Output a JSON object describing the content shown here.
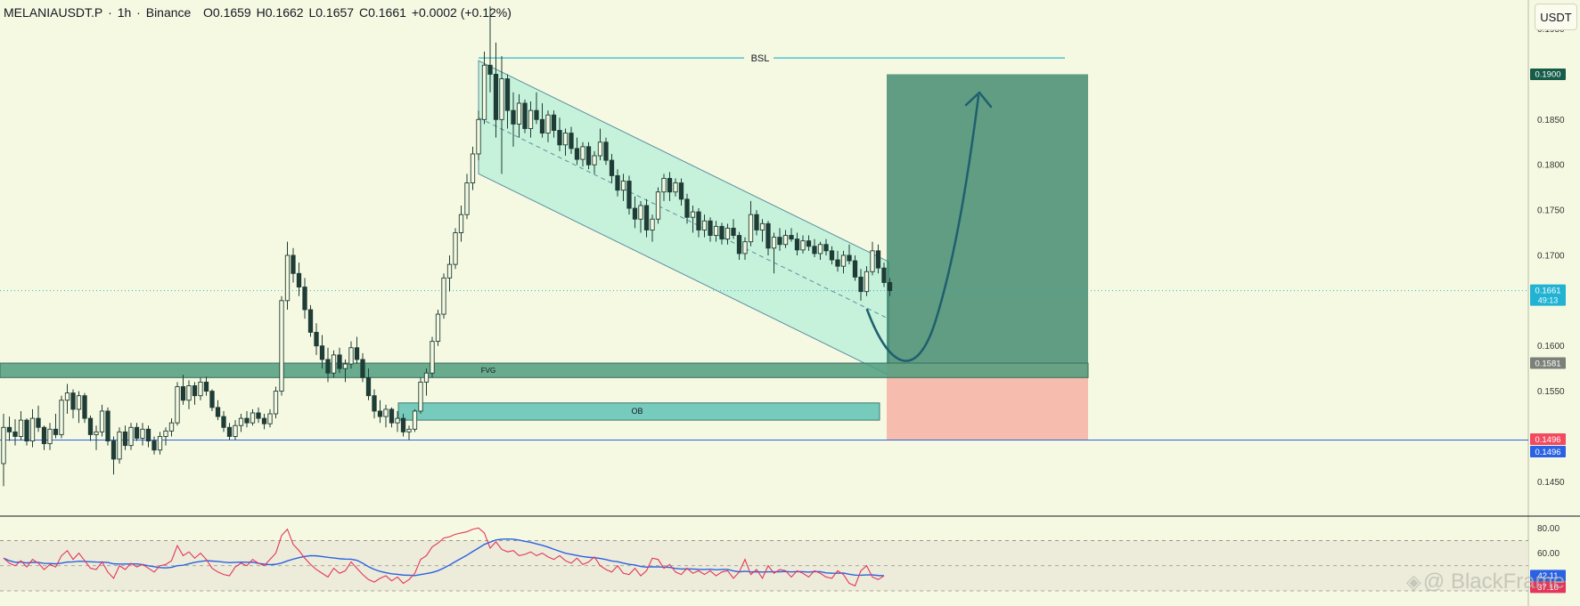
{
  "legend": {
    "symbol": "MELANIAUSDT.P",
    "interval": "1h",
    "exchange": "Binance",
    "open_label": "O",
    "open": "0.1659",
    "high_label": "H",
    "high": "0.1662",
    "low_label": "L",
    "low": "0.1657",
    "close_label": "C",
    "close": "0.1661",
    "change": "+0.0002 (+0.12%)"
  },
  "currency_button": "USDT",
  "price_axis": {
    "ticks": [
      "0.1950",
      "0.1900",
      "0.1850",
      "0.1800",
      "0.1750",
      "0.1700",
      "0.1650",
      "0.1600",
      "0.1550",
      "0.1500",
      "0.1450"
    ],
    "ticks_values": [
      0.195,
      0.19,
      0.185,
      0.18,
      0.175,
      0.17,
      0.165,
      0.16,
      0.155,
      0.15,
      0.145
    ]
  },
  "indicator_axis": {
    "ticks": [
      "80.00",
      "60.00"
    ],
    "ticks_values": [
      80,
      60
    ]
  },
  "badges": {
    "target": {
      "text": "0.1900",
      "value": 0.19,
      "color": "#165c49"
    },
    "current": {
      "text": "0.1661",
      "subtext": "49:13",
      "value": 0.1661,
      "color": "#22b3d3"
    },
    "fvg_level": {
      "text": "0.1581",
      "value": 0.1581,
      "color": "#7b8179"
    },
    "stop": {
      "text": "0.1496",
      "value": 0.1496,
      "color": "#f24a5f"
    },
    "line": {
      "text": "0.1496",
      "value": 0.1496,
      "color": "#2a62e3"
    },
    "rsi": {
      "text": "42.11",
      "value": 42.11,
      "color": "#2a62e3"
    },
    "rsi_ma": {
      "text": "37.10",
      "value": 37.1,
      "color": "#e4365a"
    }
  },
  "annotations": {
    "bsl": "BSL",
    "fvg": "FVG",
    "ob": "OB"
  },
  "watermark": {
    "text": "@ BlackFrame",
    "icon": "diamond-logo-icon"
  },
  "colors": {
    "background": "#f6f9e2",
    "bull_candle": "#1f3d36",
    "bear_candle": "#1f3d36",
    "channel_fill": "#bdf0d8",
    "channel_border": "#5a8fa3",
    "target_zone": "#2e7d63",
    "stop_zone": "#f6b2a4",
    "fvg_zone": "#4f9d7e",
    "ob_zone": "#6fc8bb",
    "bsl_line": "#2fb7cf",
    "stop_line": "#2a62e3",
    "curve_arrow": "#1f5f6e",
    "rsi_line": "#e4365a",
    "rsi_ma_line": "#2a62e3",
    "rsi_band": "#ece9d8"
  },
  "chart_data": {
    "type": "candlestick",
    "price_range": [
      0.1412,
      0.1982
    ],
    "candles": [
      [
        0.147,
        0.1525,
        0.1445,
        0.151
      ],
      [
        0.151,
        0.1522,
        0.1495,
        0.1505
      ],
      [
        0.1505,
        0.1519,
        0.149,
        0.15
      ],
      [
        0.15,
        0.1528,
        0.1496,
        0.1518
      ],
      [
        0.1518,
        0.152,
        0.149,
        0.1495
      ],
      [
        0.1495,
        0.153,
        0.1488,
        0.152
      ],
      [
        0.152,
        0.1534,
        0.1505,
        0.151
      ],
      [
        0.151,
        0.1512,
        0.1485,
        0.1492
      ],
      [
        0.1492,
        0.1515,
        0.1485,
        0.1508
      ],
      [
        0.1508,
        0.1525,
        0.1498,
        0.1502
      ],
      [
        0.1502,
        0.1545,
        0.1498,
        0.154
      ],
      [
        0.154,
        0.1558,
        0.1525,
        0.1548
      ],
      [
        0.1548,
        0.1552,
        0.152,
        0.153
      ],
      [
        0.153,
        0.155,
        0.1515,
        0.1545
      ],
      [
        0.1545,
        0.1548,
        0.1515,
        0.152
      ],
      [
        0.152,
        0.1523,
        0.1495,
        0.1502
      ],
      [
        0.1502,
        0.1512,
        0.1485,
        0.1505
      ],
      [
        0.1505,
        0.1535,
        0.15,
        0.1528
      ],
      [
        0.1528,
        0.1532,
        0.149,
        0.1495
      ],
      [
        0.1495,
        0.15,
        0.1458,
        0.1475
      ],
      [
        0.1475,
        0.151,
        0.147,
        0.1505
      ],
      [
        0.1505,
        0.1512,
        0.1485,
        0.149
      ],
      [
        0.149,
        0.1515,
        0.1485,
        0.151
      ],
      [
        0.151,
        0.1515,
        0.1495,
        0.1498
      ],
      [
        0.1498,
        0.1515,
        0.149,
        0.1508
      ],
      [
        0.1508,
        0.1512,
        0.1488,
        0.1495
      ],
      [
        0.1495,
        0.15,
        0.148,
        0.1485
      ],
      [
        0.1485,
        0.1505,
        0.148,
        0.15
      ],
      [
        0.15,
        0.151,
        0.149,
        0.1506
      ],
      [
        0.1506,
        0.152,
        0.15,
        0.1515
      ],
      [
        0.1515,
        0.156,
        0.1512,
        0.1555
      ],
      [
        0.1555,
        0.1568,
        0.1535,
        0.154
      ],
      [
        0.154,
        0.1562,
        0.153,
        0.1556
      ],
      [
        0.1556,
        0.156,
        0.1535,
        0.1545
      ],
      [
        0.1545,
        0.1565,
        0.154,
        0.156
      ],
      [
        0.156,
        0.1566,
        0.1545,
        0.155
      ],
      [
        0.155,
        0.1552,
        0.1528,
        0.1532
      ],
      [
        0.1532,
        0.154,
        0.1518,
        0.1522
      ],
      [
        0.1522,
        0.1528,
        0.1505,
        0.151
      ],
      [
        0.151,
        0.1515,
        0.1496,
        0.15
      ],
      [
        0.15,
        0.1518,
        0.1496,
        0.1512
      ],
      [
        0.1512,
        0.1525,
        0.1505,
        0.152
      ],
      [
        0.152,
        0.1528,
        0.151,
        0.1515
      ],
      [
        0.1515,
        0.153,
        0.1512,
        0.1526
      ],
      [
        0.1526,
        0.1532,
        0.1515,
        0.152
      ],
      [
        0.152,
        0.1525,
        0.1508,
        0.1514
      ],
      [
        0.1514,
        0.153,
        0.151,
        0.1525
      ],
      [
        0.1525,
        0.1555,
        0.152,
        0.155
      ],
      [
        0.155,
        0.1655,
        0.1545,
        0.165
      ],
      [
        0.165,
        0.1715,
        0.164,
        0.17
      ],
      [
        0.17,
        0.1708,
        0.167,
        0.168
      ],
      [
        0.168,
        0.1692,
        0.1655,
        0.1665
      ],
      [
        0.1665,
        0.1675,
        0.163,
        0.164
      ],
      [
        0.164,
        0.1645,
        0.161,
        0.1615
      ],
      [
        0.1615,
        0.1625,
        0.159,
        0.16
      ],
      [
        0.16,
        0.1612,
        0.1575,
        0.1585
      ],
      [
        0.1585,
        0.1598,
        0.156,
        0.157
      ],
      [
        0.157,
        0.1595,
        0.1565,
        0.159
      ],
      [
        0.159,
        0.1598,
        0.157,
        0.1575
      ],
      [
        0.1575,
        0.1585,
        0.156,
        0.158
      ],
      [
        0.158,
        0.1605,
        0.1575,
        0.1598
      ],
      [
        0.1598,
        0.161,
        0.158,
        0.1585
      ],
      [
        0.1585,
        0.1592,
        0.156,
        0.1565
      ],
      [
        0.1565,
        0.1575,
        0.154,
        0.1545
      ],
      [
        0.1545,
        0.1552,
        0.152,
        0.1528
      ],
      [
        0.1528,
        0.154,
        0.1515,
        0.1522
      ],
      [
        0.1522,
        0.1535,
        0.151,
        0.153
      ],
      [
        0.153,
        0.1532,
        0.151,
        0.1515
      ],
      [
        0.1515,
        0.1528,
        0.1505,
        0.152
      ],
      [
        0.152,
        0.1525,
        0.15,
        0.1505
      ],
      [
        0.1505,
        0.1512,
        0.1496,
        0.1508
      ],
      [
        0.1508,
        0.153,
        0.1505,
        0.1528
      ],
      [
        0.1528,
        0.1565,
        0.1525,
        0.156
      ],
      [
        0.156,
        0.1575,
        0.1545,
        0.157
      ],
      [
        0.157,
        0.161,
        0.1565,
        0.1605
      ],
      [
        0.1605,
        0.164,
        0.16,
        0.1635
      ],
      [
        0.1635,
        0.168,
        0.163,
        0.1675
      ],
      [
        0.1675,
        0.17,
        0.166,
        0.169
      ],
      [
        0.169,
        0.173,
        0.1685,
        0.1725
      ],
      [
        0.1725,
        0.1755,
        0.1715,
        0.1745
      ],
      [
        0.1745,
        0.179,
        0.174,
        0.178
      ],
      [
        0.178,
        0.182,
        0.1772,
        0.1812
      ],
      [
        0.1812,
        0.186,
        0.1805,
        0.185
      ],
      [
        0.185,
        0.1925,
        0.1845,
        0.191
      ],
      [
        0.191,
        0.1975,
        0.188,
        0.19
      ],
      [
        0.19,
        0.1935,
        0.183,
        0.185
      ],
      [
        0.185,
        0.192,
        0.179,
        0.1895
      ],
      [
        0.1895,
        0.19,
        0.184,
        0.186
      ],
      [
        0.186,
        0.188,
        0.182,
        0.1845
      ],
      [
        0.1845,
        0.1878,
        0.183,
        0.1868
      ],
      [
        0.1868,
        0.1872,
        0.1835,
        0.184
      ],
      [
        0.184,
        0.187,
        0.183,
        0.186
      ],
      [
        0.186,
        0.188,
        0.1845,
        0.185
      ],
      [
        0.185,
        0.1868,
        0.183,
        0.1835
      ],
      [
        0.1835,
        0.186,
        0.1825,
        0.1855
      ],
      [
        0.1855,
        0.186,
        0.183,
        0.1838
      ],
      [
        0.1838,
        0.1852,
        0.1815,
        0.1822
      ],
      [
        0.1822,
        0.184,
        0.181,
        0.1835
      ],
      [
        0.1835,
        0.1842,
        0.1812,
        0.1818
      ],
      [
        0.1818,
        0.183,
        0.18,
        0.1806
      ],
      [
        0.1806,
        0.1825,
        0.1798,
        0.182
      ],
      [
        0.182,
        0.1825,
        0.1795,
        0.18
      ],
      [
        0.18,
        0.1815,
        0.179,
        0.181
      ],
      [
        0.181,
        0.184,
        0.1805,
        0.1825
      ],
      [
        0.1825,
        0.183,
        0.18,
        0.1805
      ],
      [
        0.1805,
        0.1812,
        0.178,
        0.1788
      ],
      [
        0.1788,
        0.1795,
        0.1765,
        0.1772
      ],
      [
        0.1772,
        0.179,
        0.176,
        0.1782
      ],
      [
        0.1782,
        0.1788,
        0.1745,
        0.1752
      ],
      [
        0.1752,
        0.1765,
        0.173,
        0.174
      ],
      [
        0.174,
        0.176,
        0.1725,
        0.1755
      ],
      [
        0.1755,
        0.1762,
        0.172,
        0.1728
      ],
      [
        0.1728,
        0.1745,
        0.1715,
        0.174
      ],
      [
        0.174,
        0.1775,
        0.1735,
        0.177
      ],
      [
        0.177,
        0.179,
        0.176,
        0.1785
      ],
      [
        0.1785,
        0.1792,
        0.176,
        0.177
      ],
      [
        0.177,
        0.1785,
        0.1765,
        0.178
      ],
      [
        0.178,
        0.1785,
        0.1755,
        0.1762
      ],
      [
        0.1762,
        0.1768,
        0.1735,
        0.1742
      ],
      [
        0.1742,
        0.1755,
        0.1725,
        0.1748
      ],
      [
        0.1748,
        0.1752,
        0.172,
        0.1728
      ],
      [
        0.1728,
        0.1745,
        0.172,
        0.1738
      ],
      [
        0.1738,
        0.1742,
        0.1715,
        0.1722
      ],
      [
        0.1722,
        0.1738,
        0.1715,
        0.1732
      ],
      [
        0.1732,
        0.1736,
        0.1712,
        0.1718
      ],
      [
        0.1718,
        0.1735,
        0.1712,
        0.173
      ],
      [
        0.173,
        0.174,
        0.1718,
        0.1722
      ],
      [
        0.1722,
        0.1726,
        0.1695,
        0.1702
      ],
      [
        0.1702,
        0.172,
        0.1695,
        0.1715
      ],
      [
        0.1715,
        0.176,
        0.171,
        0.1745
      ],
      [
        0.1745,
        0.175,
        0.1722,
        0.1728
      ],
      [
        0.1728,
        0.174,
        0.1715,
        0.1735
      ],
      [
        0.1735,
        0.1738,
        0.17,
        0.1708
      ],
      [
        0.1708,
        0.1725,
        0.168,
        0.172
      ],
      [
        0.172,
        0.173,
        0.1705,
        0.1712
      ],
      [
        0.1712,
        0.1728,
        0.1708,
        0.1722
      ],
      [
        0.1722,
        0.173,
        0.1715,
        0.1718
      ],
      [
        0.1718,
        0.1725,
        0.17,
        0.1706
      ],
      [
        0.1706,
        0.1722,
        0.1702,
        0.1716
      ],
      [
        0.1716,
        0.1722,
        0.1705,
        0.171
      ],
      [
        0.171,
        0.1718,
        0.1698,
        0.1702
      ],
      [
        0.1702,
        0.1715,
        0.1695,
        0.1712
      ],
      [
        0.1712,
        0.1718,
        0.17,
        0.1705
      ],
      [
        0.1705,
        0.171,
        0.169,
        0.1695
      ],
      [
        0.1695,
        0.1705,
        0.1682,
        0.1688
      ],
      [
        0.1688,
        0.1705,
        0.168,
        0.17
      ],
      [
        0.17,
        0.1712,
        0.169,
        0.1694
      ],
      [
        0.1694,
        0.17,
        0.1672,
        0.1676
      ],
      [
        0.1676,
        0.1685,
        0.165,
        0.166
      ],
      [
        0.166,
        0.1688,
        0.1655,
        0.1682
      ],
      [
        0.1682,
        0.1715,
        0.1678,
        0.1705
      ],
      [
        0.1705,
        0.1712,
        0.168,
        0.1686
      ],
      [
        0.1686,
        0.1692,
        0.1665,
        0.167
      ],
      [
        0.167,
        0.1675,
        0.1655,
        0.1661
      ]
    ],
    "rsi": [
      56,
      52,
      50,
      54,
      49,
      55,
      52,
      47,
      51,
      49,
      58,
      62,
      55,
      60,
      54,
      48,
      47,
      53,
      45,
      40,
      50,
      47,
      52,
      49,
      51,
      48,
      45,
      50,
      51,
      54,
      66,
      58,
      61,
      56,
      60,
      55,
      48,
      45,
      43,
      42,
      49,
      52,
      50,
      55,
      52,
      50,
      55,
      60,
      74,
      79,
      67,
      62,
      56,
      51,
      47,
      44,
      41,
      48,
      44,
      46,
      53,
      48,
      43,
      39,
      37,
      40,
      42,
      38,
      41,
      36,
      39,
      44,
      55,
      58,
      65,
      68,
      72,
      73,
      75,
      76,
      77,
      79,
      80,
      76,
      64,
      69,
      63,
      61,
      62,
      58,
      59,
      61,
      58,
      60,
      57,
      55,
      58,
      54,
      52,
      56,
      51,
      53,
      57,
      50,
      47,
      45,
      50,
      44,
      43,
      48,
      42,
      46,
      56,
      55,
      48,
      51,
      45,
      43,
      48,
      44,
      46,
      43,
      46,
      42,
      45,
      46,
      40,
      45,
      55,
      43,
      47,
      40,
      50,
      44,
      47,
      46,
      41,
      46,
      44,
      41,
      46,
      44,
      41,
      40,
      46,
      43,
      36,
      34,
      46,
      50,
      41,
      39,
      42
    ],
    "rsi_range": [
      30,
      85
    ]
  }
}
